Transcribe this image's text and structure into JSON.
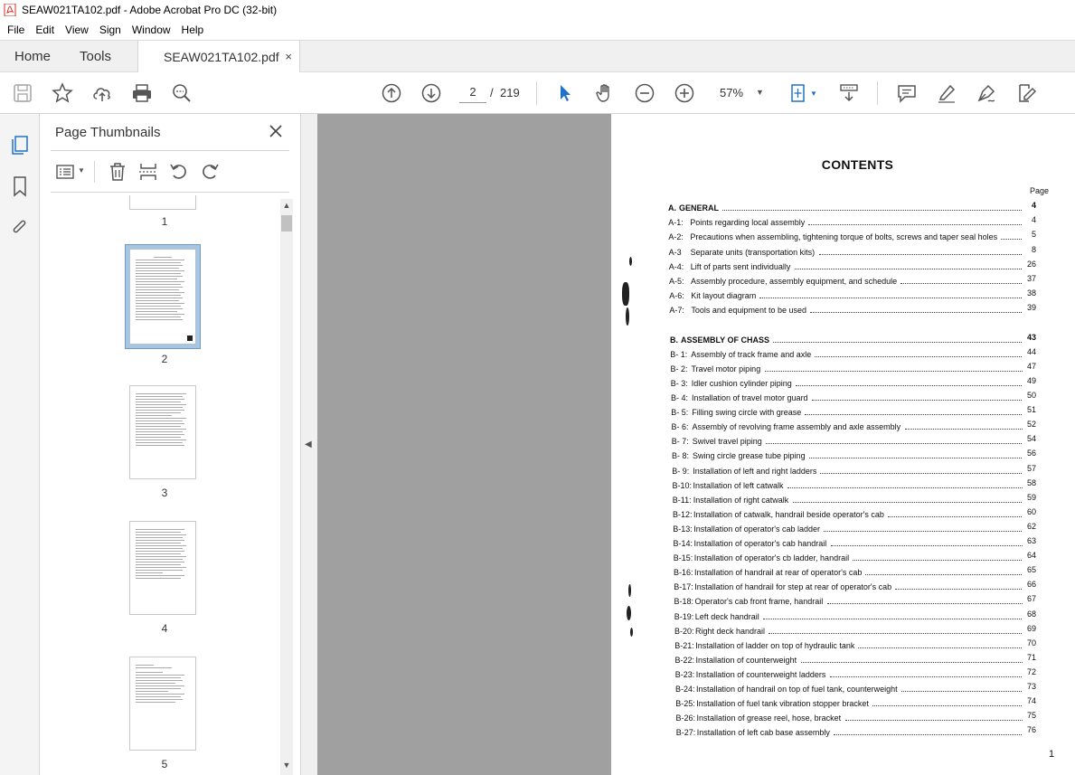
{
  "window": {
    "title": "SEAW021TA102.pdf - Adobe Acrobat Pro DC (32-bit)"
  },
  "menu": [
    "File",
    "Edit",
    "View",
    "Sign",
    "Window",
    "Help"
  ],
  "tabs": {
    "home": "Home",
    "tools": "Tools",
    "document": "SEAW021TA102.pdf",
    "close": "×"
  },
  "toolbar": {
    "current_page": "2",
    "page_separator": "/",
    "total_pages": "219",
    "zoom": "57%",
    "zoom_caret": "▼"
  },
  "thumbnails": {
    "title": "Page Thumbnails",
    "pages": [
      {
        "label": "1"
      },
      {
        "label": "2"
      },
      {
        "label": "3"
      },
      {
        "label": "4"
      },
      {
        "label": "5"
      }
    ]
  },
  "document": {
    "title": "CONTENTS",
    "page_column_label": "Page",
    "footer_page": "1",
    "entries": [
      {
        "code": "A.",
        "text": "GENERAL",
        "page": "4",
        "section": true
      },
      {
        "code": "A-1:",
        "text": "Points regarding local assembly",
        "page": "4"
      },
      {
        "code": "A-2:",
        "text": "Precautions when assembling, tightening torque of bolts, screws and taper seal holes",
        "page": "5"
      },
      {
        "code": "A-3",
        "text": "Separate units (transportation kits)",
        "page": "8"
      },
      {
        "code": "A-4:",
        "text": "Lift of parts sent individually",
        "page": "26"
      },
      {
        "code": "A-5:",
        "text": "Assembly procedure, assembly equipment, and schedule",
        "page": "37"
      },
      {
        "code": "A-6:",
        "text": "Kit layout diagram",
        "page": "38"
      },
      {
        "code": "A-7:",
        "text": "Tools and equipment to be used",
        "page": "39"
      },
      {
        "code": "B.",
        "text": "ASSEMBLY OF CHASS",
        "page": "43",
        "section": true
      },
      {
        "code": "B- 1:",
        "text": "Assembly of track frame and axle",
        "page": "44"
      },
      {
        "code": "B- 2:",
        "text": "Travel motor piping",
        "page": "47"
      },
      {
        "code": "B- 3:",
        "text": "Idler cushion cylinder piping",
        "page": "49"
      },
      {
        "code": "B- 4:",
        "text": "Installation of travel motor guard",
        "page": "50"
      },
      {
        "code": "B- 5:",
        "text": "Filling swing circle with grease",
        "page": "51"
      },
      {
        "code": "B- 6:",
        "text": "Assembly of revolving frame assembly and axle assembly",
        "page": "52"
      },
      {
        "code": "B- 7:",
        "text": "Swivel travel piping",
        "page": "54"
      },
      {
        "code": "B- 8:",
        "text": "Swing circle grease tube piping",
        "page": "56"
      },
      {
        "code": "B- 9:",
        "text": "Installation of left and right ladders",
        "page": "57"
      },
      {
        "code": "B-10:",
        "text": "Installation of left catwalk",
        "page": "58"
      },
      {
        "code": "B-11:",
        "text": "Installation of right catwalk",
        "page": "59"
      },
      {
        "code": "B-12:",
        "text": "Installation of catwalk, handrail beside operator's cab",
        "page": "60"
      },
      {
        "code": "B-13:",
        "text": "Installation of operator's cab ladder",
        "page": "62"
      },
      {
        "code": "B-14:",
        "text": "Installation of operator's cab handrail",
        "page": "63"
      },
      {
        "code": "B-15:",
        "text": "Installation of operator's cb ladder, handrail",
        "page": "64"
      },
      {
        "code": "B-16:",
        "text": "Installation of handrail at rear of operator's cab",
        "page": "65"
      },
      {
        "code": "B-17:",
        "text": "Installation of handrail for step at rear of operator's cab",
        "page": "66"
      },
      {
        "code": "B-18:",
        "text": "Operator's cab front frame, handrail",
        "page": "67"
      },
      {
        "code": "B-19:",
        "text": "Left deck handrail",
        "page": "68"
      },
      {
        "code": "B-20:",
        "text": "Right deck handrail",
        "page": "69"
      },
      {
        "code": "B-21:",
        "text": "Installation of ladder on top of hydraulic tank",
        "page": "70"
      },
      {
        "code": "B-22:",
        "text": "Installation of counterweight",
        "page": "71"
      },
      {
        "code": "B-23:",
        "text": "Installation of counterweight ladders",
        "page": "72"
      },
      {
        "code": "B-24:",
        "text": "Installation of handrail on top of fuel tank, counterweight",
        "page": "73"
      },
      {
        "code": "B-25:",
        "text": "Installation of fuel tank vibration stopper bracket",
        "page": "74"
      },
      {
        "code": "B-26:",
        "text": "Installation of grease reel, hose, bracket",
        "page": "75"
      },
      {
        "code": "B-27:",
        "text": "Installation of left cab base assembly",
        "page": "76"
      }
    ]
  }
}
